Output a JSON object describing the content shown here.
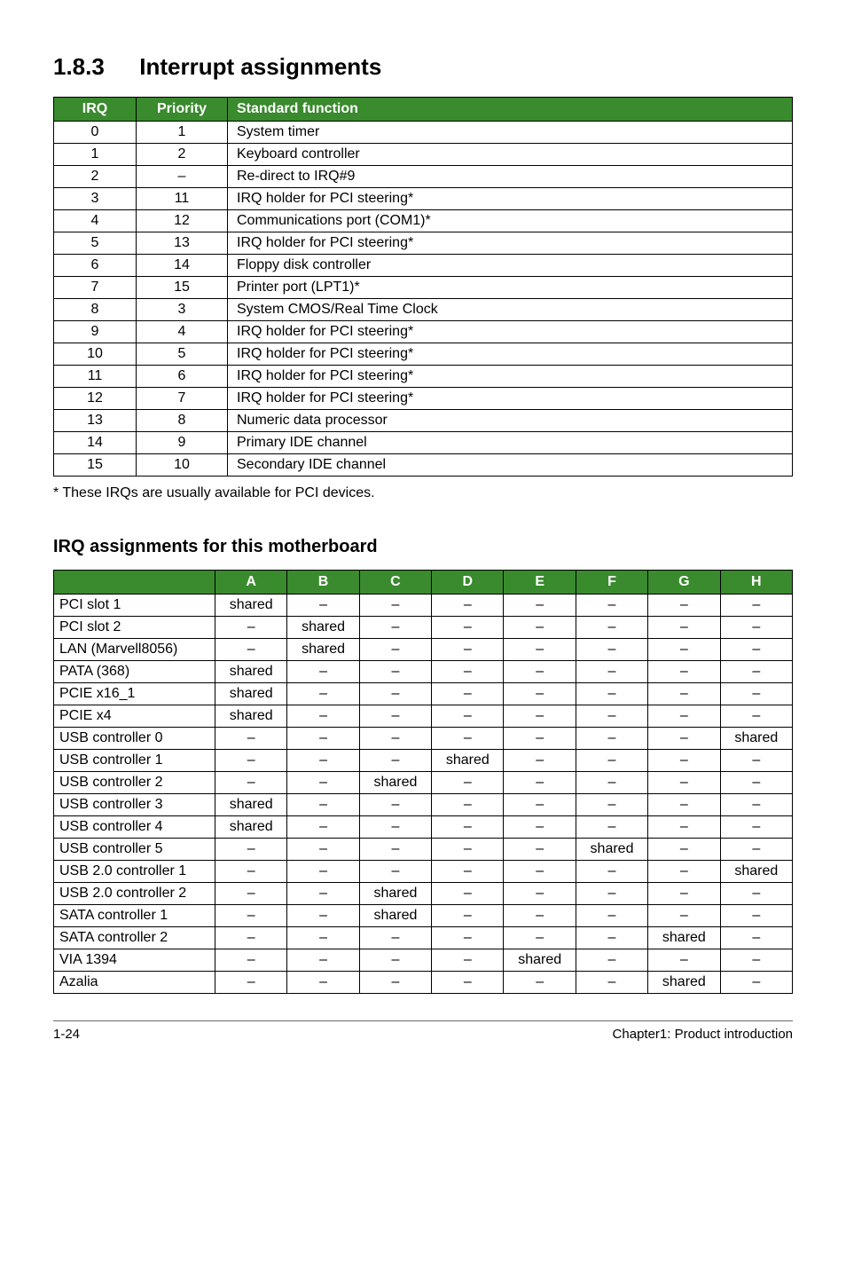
{
  "heading_number": "1.8.3",
  "heading_text": "Interrupt assignments",
  "irq_table": {
    "headers": {
      "irq": "IRQ",
      "priority": "Priority",
      "func": "Standard function"
    },
    "rows": [
      {
        "irq": "0",
        "priority": "1",
        "func": "System timer"
      },
      {
        "irq": "1",
        "priority": "2",
        "func": "Keyboard controller"
      },
      {
        "irq": "2",
        "priority": "–",
        "func": "Re-direct to IRQ#9"
      },
      {
        "irq": "3",
        "priority": "11",
        "func": "IRQ holder for PCI steering*"
      },
      {
        "irq": "4",
        "priority": "12",
        "func": "Communications port (COM1)*"
      },
      {
        "irq": "5",
        "priority": "13",
        "func": "IRQ holder for PCI steering*"
      },
      {
        "irq": "6",
        "priority": "14",
        "func": "Floppy disk controller"
      },
      {
        "irq": "7",
        "priority": "15",
        "func": "Printer port (LPT1)*"
      },
      {
        "irq": "8",
        "priority": "3",
        "func": "System CMOS/Real Time Clock"
      },
      {
        "irq": "9",
        "priority": "4",
        "func": "IRQ holder for PCI steering*"
      },
      {
        "irq": "10",
        "priority": "5",
        "func": "IRQ holder for PCI steering*"
      },
      {
        "irq": "11",
        "priority": "6",
        "func": "IRQ holder for PCI steering*"
      },
      {
        "irq": "12",
        "priority": "7",
        "func": "IRQ holder for PCI steering*"
      },
      {
        "irq": "13",
        "priority": "8",
        "func": "Numeric data processor"
      },
      {
        "irq": "14",
        "priority": "9",
        "func": "Primary IDE channel"
      },
      {
        "irq": "15",
        "priority": "10",
        "func": "Secondary IDE channel"
      }
    ]
  },
  "footnote": "* These IRQs are usually available for PCI devices.",
  "subheading": "IRQ assignments for this motherboard",
  "assign_table": {
    "columns": [
      "A",
      "B",
      "C",
      "D",
      "E",
      "F",
      "G",
      "H"
    ],
    "rows": [
      {
        "label": "PCI slot 1",
        "cells": [
          "shared",
          "–",
          "–",
          "–",
          "–",
          "–",
          "–",
          "–"
        ]
      },
      {
        "label": "PCI slot 2",
        "cells": [
          "–",
          "shared",
          "–",
          "–",
          "–",
          "–",
          "–",
          "–"
        ]
      },
      {
        "label": "LAN (Marvell8056)",
        "cells": [
          "–",
          "shared",
          "–",
          "–",
          "–",
          "–",
          "–",
          "–"
        ]
      },
      {
        "label": "PATA (368)",
        "cells": [
          "shared",
          "–",
          "–",
          "–",
          "–",
          "–",
          "–",
          "–"
        ]
      },
      {
        "label": "PCIE x16_1",
        "cells": [
          "shared",
          "–",
          "–",
          "–",
          "–",
          "–",
          "–",
          "–"
        ]
      },
      {
        "label": "PCIE x4",
        "cells": [
          "shared",
          "–",
          "–",
          "–",
          "–",
          "–",
          "–",
          "–"
        ]
      },
      {
        "label": "USB controller 0",
        "cells": [
          "–",
          "–",
          "–",
          "–",
          "–",
          "–",
          "–",
          "shared"
        ]
      },
      {
        "label": "USB controller 1",
        "cells": [
          "–",
          "–",
          "–",
          "shared",
          "–",
          "–",
          "–",
          "–"
        ]
      },
      {
        "label": "USB controller 2",
        "cells": [
          "–",
          "–",
          "shared",
          "–",
          "–",
          "–",
          "–",
          "–"
        ]
      },
      {
        "label": "USB controller 3",
        "cells": [
          "shared",
          "–",
          "–",
          "–",
          "–",
          "–",
          "–",
          "–"
        ]
      },
      {
        "label": "USB controller 4",
        "cells": [
          "shared",
          "–",
          "–",
          "–",
          "–",
          "–",
          "–",
          "–"
        ]
      },
      {
        "label": "USB controller 5",
        "cells": [
          "–",
          "–",
          "–",
          "–",
          "–",
          "shared",
          "–",
          "–"
        ]
      },
      {
        "label": "USB 2.0 controller 1",
        "cells": [
          "–",
          "–",
          "–",
          "–",
          "–",
          "–",
          "–",
          "shared"
        ]
      },
      {
        "label": "USB 2.0 controller 2",
        "cells": [
          "–",
          "–",
          "shared",
          "–",
          "–",
          "–",
          "–",
          "–"
        ]
      },
      {
        "label": "SATA controller 1",
        "cells": [
          "–",
          "–",
          "shared",
          "–",
          "–",
          "–",
          "–",
          "–"
        ]
      },
      {
        "label": "SATA controller 2",
        "cells": [
          "–",
          "–",
          "–",
          "–",
          "–",
          "–",
          "shared",
          "–"
        ]
      },
      {
        "label": "VIA 1394",
        "cells": [
          "–",
          "–",
          "–",
          "–",
          "shared",
          "–",
          "–",
          "–"
        ]
      },
      {
        "label": "Azalia",
        "cells": [
          "–",
          "–",
          "–",
          "–",
          "–",
          "–",
          "shared",
          "–"
        ]
      }
    ]
  },
  "footer": {
    "left": "1-24",
    "right": "Chapter1: Product introduction"
  }
}
